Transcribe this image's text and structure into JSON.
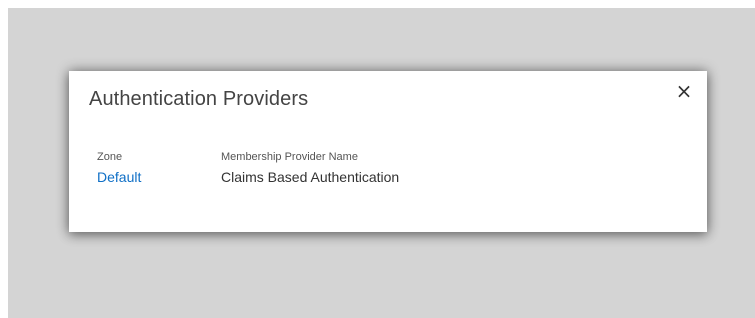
{
  "dialog": {
    "title": "Authentication Providers",
    "close_glyph": "×",
    "table": {
      "headers": [
        "Zone",
        "Membership Provider Name"
      ],
      "rows": [
        {
          "zone": "Default",
          "provider": "Claims Based Authentication"
        }
      ]
    }
  },
  "colors": {
    "overlay": "#d4d4d4",
    "link": "#0f6fc6",
    "title_text": "#444444"
  },
  "icons": {
    "close": "close-icon"
  }
}
